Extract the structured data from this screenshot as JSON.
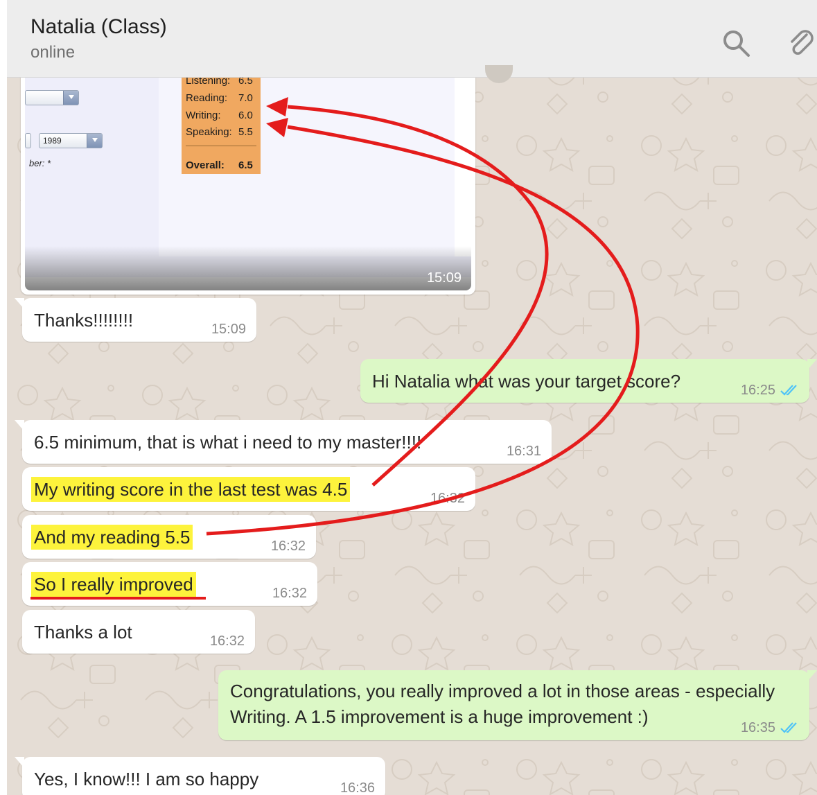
{
  "header": {
    "contact_name": "Natalia (Class)",
    "status": "online",
    "search_icon": "search-icon",
    "attach_icon": "paperclip-icon"
  },
  "image_message": {
    "year_value": "1989",
    "field_label": "ber: *",
    "scores": [
      {
        "label": "Listening:",
        "value": "6.5"
      },
      {
        "label": "Reading:",
        "value": "7.0"
      },
      {
        "label": "Writing:",
        "value": "6.0"
      },
      {
        "label": "Speaking:",
        "value": "5.5"
      }
    ],
    "overall_label": "Overall:",
    "overall_value": "6.5",
    "time": "15:09"
  },
  "messages": [
    {
      "id": "m1",
      "direction": "incoming",
      "text": "Thanks!!!!!!!!",
      "time": "15:09",
      "highlight": false
    },
    {
      "id": "m2",
      "direction": "outgoing",
      "text": "Hi Natalia what was your target score?",
      "time": "16:25",
      "read": true
    },
    {
      "id": "m3",
      "direction": "incoming",
      "text": "6.5 minimum, that is what i need to my master!!!!",
      "time": "16:31",
      "highlight": false
    },
    {
      "id": "m4",
      "direction": "incoming",
      "text": "My writing score in the last test was 4.5",
      "time": "16:32",
      "highlight": true
    },
    {
      "id": "m5",
      "direction": "incoming",
      "text": "And my reading 5.5",
      "time": "16:32",
      "highlight": true
    },
    {
      "id": "m6",
      "direction": "incoming",
      "text": "So I really improved",
      "time": "16:32",
      "highlight": true,
      "underline": true
    },
    {
      "id": "m7",
      "direction": "incoming",
      "text": "Thanks a lot",
      "time": "16:32",
      "highlight": false
    },
    {
      "id": "m8",
      "direction": "outgoing",
      "text": "Congratulations, you really improved a lot in those areas - especially Writing. A 1.5 improvement is a huge improvement :)",
      "time": "16:35",
      "read": true
    },
    {
      "id": "m9",
      "direction": "incoming",
      "text": "Yes, I know!!! I am so happy",
      "time": "16:36",
      "highlight": false
    }
  ],
  "colors": {
    "chat_background": "#e5ddd5",
    "incoming_bubble": "#ffffff",
    "outgoing_bubble": "#dcf8c6",
    "highlight": "#fdf33c",
    "annotation_red": "#e41c1c",
    "read_ticks": "#4fc3f7",
    "score_box": "#f0a860"
  }
}
